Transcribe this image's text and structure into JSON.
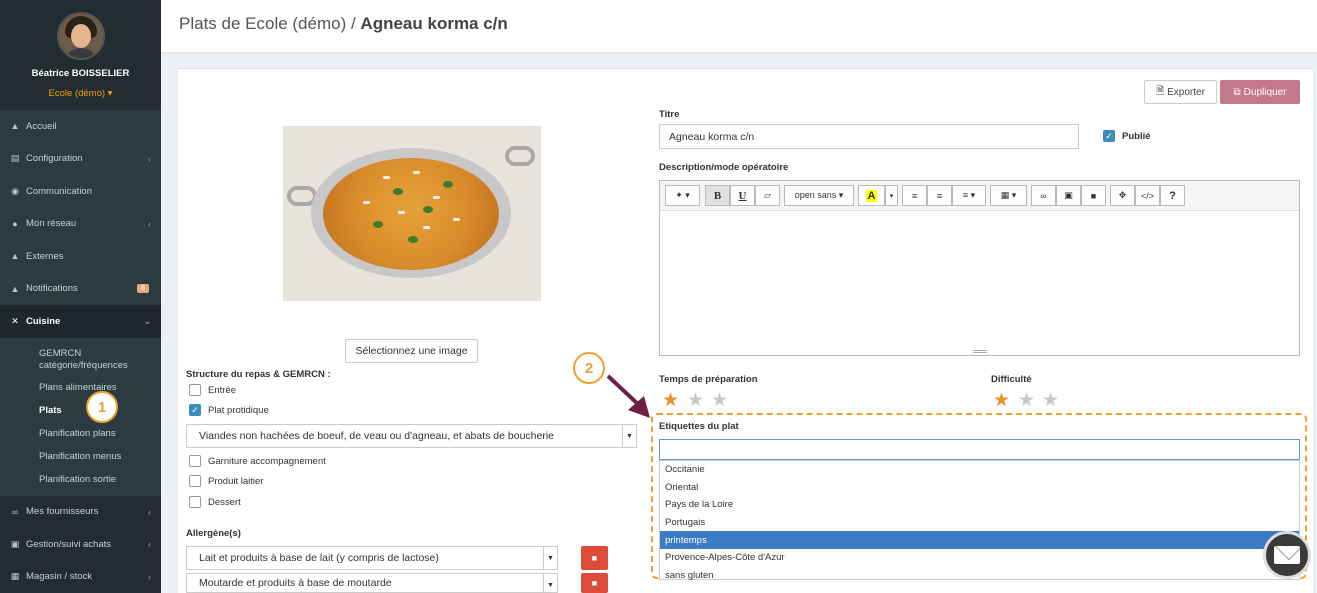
{
  "profile": {
    "name": "Béatrice BOISSELIER",
    "org": "Ecole (démo) ▾"
  },
  "sidebar": {
    "items": [
      {
        "label": "Accueil",
        "icon": "home-icon"
      },
      {
        "label": "Configuration",
        "icon": "bank-icon"
      },
      {
        "label": "Communication",
        "icon": "chat-icon"
      },
      {
        "label": "Mon réseau",
        "icon": "users-icon"
      },
      {
        "label": "Externes",
        "icon": "home-icon"
      },
      {
        "label": "Notifications",
        "icon": "bell-icon",
        "badge": "6"
      },
      {
        "label": "Cuisine",
        "icon": "cutlery-icon"
      }
    ],
    "cuisine_sub": [
      "GEMRCN catégorie/fréquences",
      "Plans alimentaires",
      "Plats",
      "Planification plans",
      "Planification menus",
      "Planification sortie"
    ],
    "bottom_items": [
      {
        "label": "Mes fournisseurs",
        "icon": "handshake-icon"
      },
      {
        "label": "Gestion/suivi achats",
        "icon": "cart-icon"
      },
      {
        "label": "Magasin / stock",
        "icon": "cubes-icon"
      }
    ]
  },
  "header": {
    "prefix": "Plats de Ecole (démo) / ",
    "title": "Agneau korma c/n"
  },
  "buttons": {
    "export": "Exporter",
    "duplicate": "Dupliquer",
    "select_image": "Sélectionnez une image"
  },
  "structure": {
    "label": "Structure du repas & GEMRCN :",
    "entree": "Entrée",
    "plat": "Plat protidique",
    "plat_select": "Viandes non hachées de boeuf, de veau ou d'agneau, et abats de boucherie",
    "garniture": "Garniture accompagnement",
    "laitier": "Produit laitier",
    "dessert": "Dessert"
  },
  "allergenes": {
    "label": "Allergène(s)",
    "items": [
      "Lait et produits à base de lait (y compris de lactose)",
      "Moutarde et produits à base de moutarde"
    ]
  },
  "form": {
    "titre_label": "Titre",
    "titre_value": "Agneau korma c/n",
    "publie": "Publié",
    "description_label": "Description/mode opératoire",
    "font": "open sans ▾",
    "temps_label": "Temps de préparation",
    "temps_rating": 1,
    "difficulte_label": "Difficulté",
    "difficulte_rating": 1,
    "etiquettes_label": "Etiquettes du plat",
    "etiquettes_options": [
      "Occitanie",
      "Oriental",
      "Pays de la Loire",
      "Portugais",
      "printemps",
      "Provence-Alpes-Côte d'Azur",
      "sans gluten"
    ],
    "etiquettes_selected": "printemps"
  },
  "callouts": {
    "one": "1",
    "two": "2"
  },
  "colors": {
    "accent": "#f0a030",
    "duplicate": "#c4788e",
    "selected": "#3c7bc6",
    "sidebar": "#2c3b41"
  }
}
